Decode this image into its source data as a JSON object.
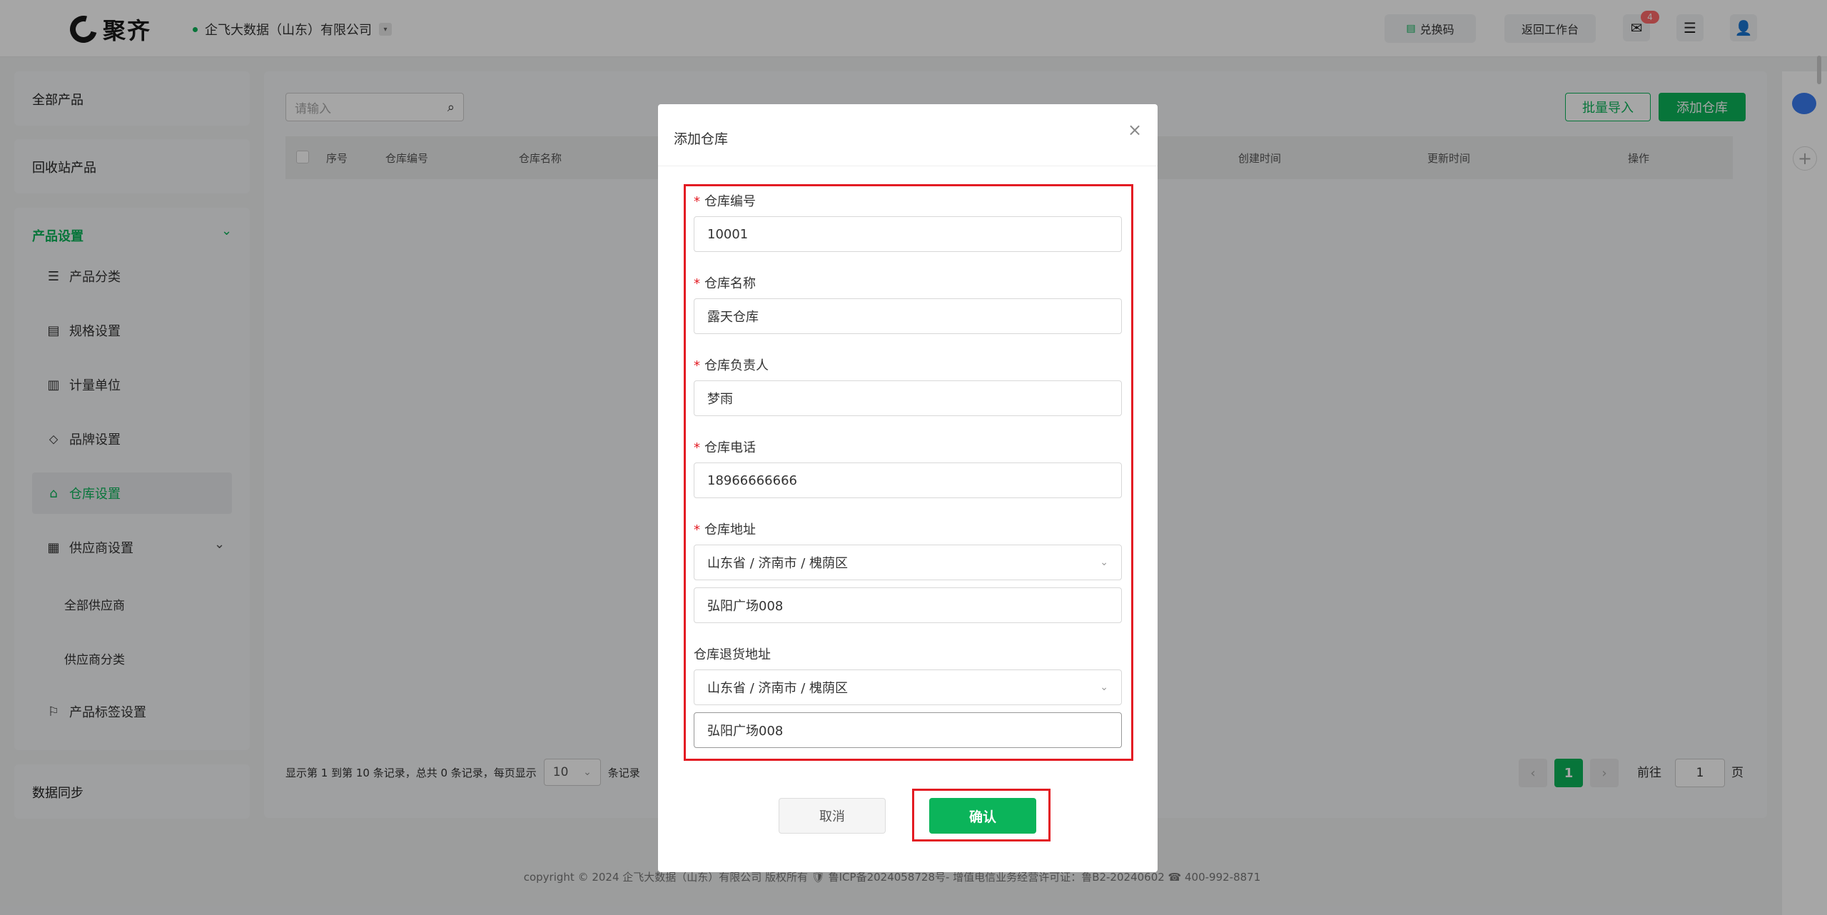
{
  "header": {
    "logo_text": "聚齐",
    "company": "企飞大数据（山东）有限公司",
    "redeem_label": "兑换码",
    "back_label": "返回工作台",
    "mail_badge": "4"
  },
  "sidebar": {
    "all_products": "全部产品",
    "recycle_products": "回收站产品",
    "product_settings": "产品设置",
    "items": [
      {
        "label": "产品分类"
      },
      {
        "label": "规格设置"
      },
      {
        "label": "计量单位"
      },
      {
        "label": "品牌设置"
      },
      {
        "label": "仓库设置"
      },
      {
        "label": "供应商设置"
      }
    ],
    "supplier_sub": [
      "全部供应商",
      "供应商分类"
    ],
    "tag_settings": "产品标签设置",
    "data_sync": "数据同步"
  },
  "main": {
    "search_placeholder": "请输入",
    "batch_import": "批量导入",
    "add_warehouse": "添加仓库",
    "columns": [
      "序号",
      "仓库编号",
      "仓库名称",
      "创建时间",
      "更新时间",
      "操作"
    ],
    "footer": {
      "summary": "显示第 1 到第 10 条记录，总共 0 条记录，每页显示",
      "page_size": "10",
      "suffix": "条记录",
      "current_page": "1",
      "goto_label": "前往",
      "goto_value": "1",
      "page_unit": "页"
    }
  },
  "copyright": "copyright © 2024 企飞大数据（山东）有限公司 版权所有  🛡 鲁ICP备2024058728号-  增值电信业务经营许可证：鲁B2-20240602 ☎ 400-992-8871",
  "modal": {
    "title": "添加仓库",
    "fields": {
      "code_label": "仓库编号",
      "code_value": "10001",
      "name_label": "仓库名称",
      "name_value": "露天仓库",
      "manager_label": "仓库负责人",
      "manager_value": "梦雨",
      "phone_label": "仓库电话",
      "phone_value": "18966666666",
      "address_label": "仓库地址",
      "address_region": "山东省 / 济南市 / 槐荫区",
      "address_detail": "弘阳广场008",
      "return_label": "仓库退货地址",
      "return_region": "山东省 / 济南市 / 槐荫区",
      "return_detail": "弘阳广场008"
    },
    "cancel": "取消",
    "confirm": "确认"
  },
  "colors": {
    "brand_green": "#0bb45a",
    "highlight_red": "#e31b23"
  }
}
